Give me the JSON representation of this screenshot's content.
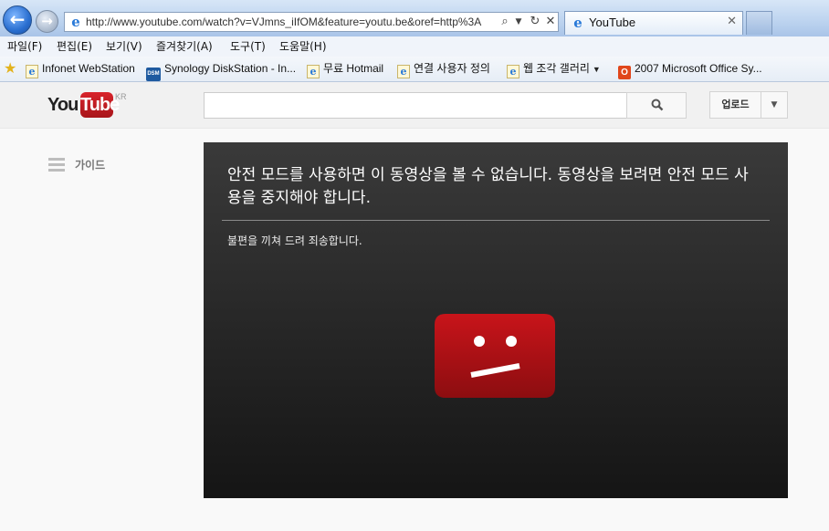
{
  "browser": {
    "url": "http://www.youtube.com/watch?v=VJmns_iIfOM&feature=youtu.be&oref=http%3A",
    "tab_title": "YouTube",
    "menu": [
      "파일(F)",
      "편집(E)",
      "보기(V)",
      "즐겨찾기(A)",
      "도구(T)",
      "도움말(H)"
    ],
    "favorites": [
      {
        "label": "Infonet WebStation",
        "icon": "ie-page-icon"
      },
      {
        "label": "Synology DiskStation - In...",
        "icon": "dsm-icon"
      },
      {
        "label": "무료 Hotmail",
        "icon": "ie-page-icon"
      },
      {
        "label": "연결 사용자 정의",
        "icon": "ie-page-icon"
      },
      {
        "label": "웹 조각 갤러리",
        "icon": "ie-page-icon"
      },
      {
        "label": "2007 Microsoft Office Sy...",
        "icon": "office-icon"
      }
    ]
  },
  "youtube": {
    "logo_you": "You",
    "logo_tube": "Tube",
    "logo_region": "KR",
    "search_placeholder": "",
    "upload_label": "업로드",
    "guide_label": "가이드",
    "error_title": "안전 모드를 사용하면 이 동영상을 볼 수 없습니다. 동영상을 보려면 안전 모드 사용을 중지해야 합니다.",
    "error_subtitle": "불편을 끼쳐 드려 죄송합니다.",
    "brand_color": "#cc181e"
  }
}
